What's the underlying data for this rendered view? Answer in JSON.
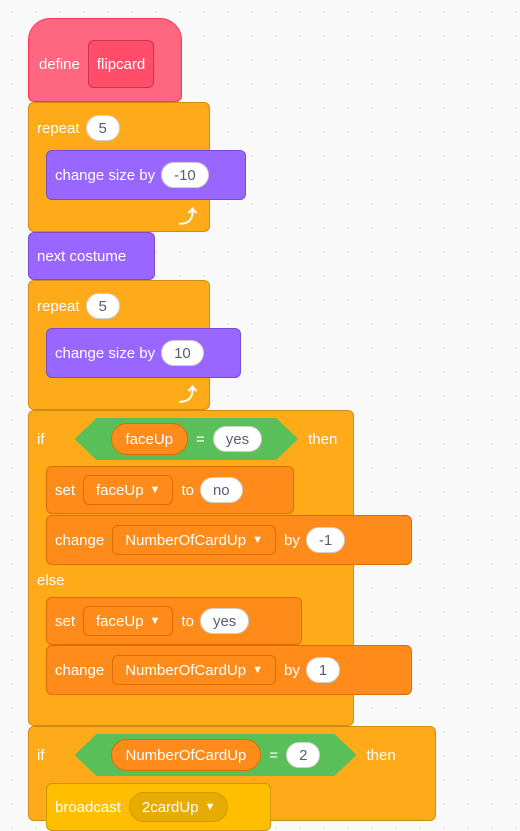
{
  "define_block": {
    "label": "define",
    "name": "flipcard"
  },
  "repeat1": {
    "label": "repeat",
    "times": "5",
    "loop_icon": "loop-arrow"
  },
  "change_size1": {
    "label": "change size by",
    "value": "-10"
  },
  "next_costume": {
    "label": "next costume"
  },
  "repeat2": {
    "label": "repeat",
    "times": "5",
    "loop_icon": "loop-arrow"
  },
  "change_size2": {
    "label": "change size by",
    "value": "10"
  },
  "if1": {
    "if_label": "if",
    "then_label": "then",
    "cond": {
      "variable": "faceUp",
      "op": "=",
      "value": "yes"
    }
  },
  "set1": {
    "label": "set",
    "variable": "faceUp",
    "to_label": "to",
    "value": "no"
  },
  "change1": {
    "label": "change",
    "variable": "NumberOfCardUp",
    "by_label": "by",
    "value": "-1"
  },
  "else_label": "else",
  "set2": {
    "label": "set",
    "variable": "faceUp",
    "to_label": "to",
    "value": "yes"
  },
  "change2": {
    "label": "change",
    "variable": "NumberOfCardUp",
    "by_label": "by",
    "value": "1"
  },
  "if2": {
    "if_label": "if",
    "then_label": "then",
    "cond": {
      "variable": "NumberOfCardUp",
      "op": "=",
      "value": "2"
    }
  },
  "broadcast": {
    "label": "broadcast",
    "message": "2cardUp"
  },
  "colors": {
    "control": "#ffab19",
    "looks": "#9966ff",
    "define": "#ff6680",
    "variables": "#ff8c1a",
    "operators": "#59c059",
    "events": "#ffbf00"
  }
}
